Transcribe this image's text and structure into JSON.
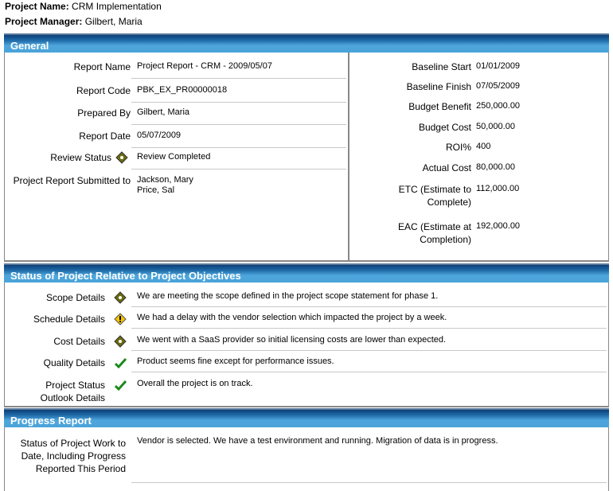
{
  "project": {
    "name_label": "Project Name:",
    "name": "CRM Implementation",
    "manager_label": "Project Manager:",
    "manager": "Gilbert, Maria"
  },
  "general": {
    "title": "General",
    "left": [
      {
        "label": "Report Name",
        "value": "Project Report - CRM - 2009/05/07"
      },
      {
        "label": "Report Code",
        "value": "PBK_EX_PR00000018"
      },
      {
        "label": "Prepared By",
        "value": "Gilbert, Maria"
      },
      {
        "label": "Report Date",
        "value": "05/07/2009"
      },
      {
        "label": "Review Status",
        "value": "Review Completed",
        "icon": "green-diamond-icon"
      },
      {
        "label": "Project Report Submitted to",
        "value": "Jackson, Mary",
        "value2": "Price, Sal"
      }
    ],
    "right": [
      {
        "label": "Baseline Start",
        "value": "01/01/2009"
      },
      {
        "label": "Baseline Finish",
        "value": "07/05/2009"
      },
      {
        "label": "Budget Benefit",
        "value": "250,000.00"
      },
      {
        "label": "Budget Cost",
        "value": "50,000.00"
      },
      {
        "label": "ROI%",
        "value": "400"
      },
      {
        "label": "Actual Cost",
        "value": "80,000.00"
      },
      {
        "label": "ETC (Estimate to",
        "label2": "Complete)",
        "value": "112,000.00"
      },
      {
        "label": "EAC (Estimate at",
        "label2": "Completion)",
        "value": "192,000.00"
      }
    ]
  },
  "status": {
    "title": "Status of Project Relative to Project Objectives",
    "rows": [
      {
        "label": "Scope Details",
        "icon": "green-diamond-icon",
        "value": "We are meeting the scope defined in the project scope statement for phase 1."
      },
      {
        "label": "Schedule Details",
        "icon": "warning-diamond-icon",
        "value": "We had a delay with the vendor selection which impacted the project by a week."
      },
      {
        "label": "Cost Details",
        "icon": "green-diamond-icon",
        "value": "We went with a SaaS provider so initial licensing costs are lower than expected."
      },
      {
        "label": "Quality Details",
        "icon": "checkmark-icon",
        "value": "Product seems fine except for performance issues."
      },
      {
        "label": "Project Status",
        "label2": "Outlook Details",
        "icon": "checkmark-icon",
        "value": "Overall the project is on track."
      }
    ]
  },
  "progress": {
    "title": "Progress Report",
    "label": "Status of Project Work to",
    "label2": "Date, Including Progress",
    "label3": "Reported This Period",
    "value": "Vendor is selected.  We have a test environment and running.  Migration of data is in progress."
  }
}
